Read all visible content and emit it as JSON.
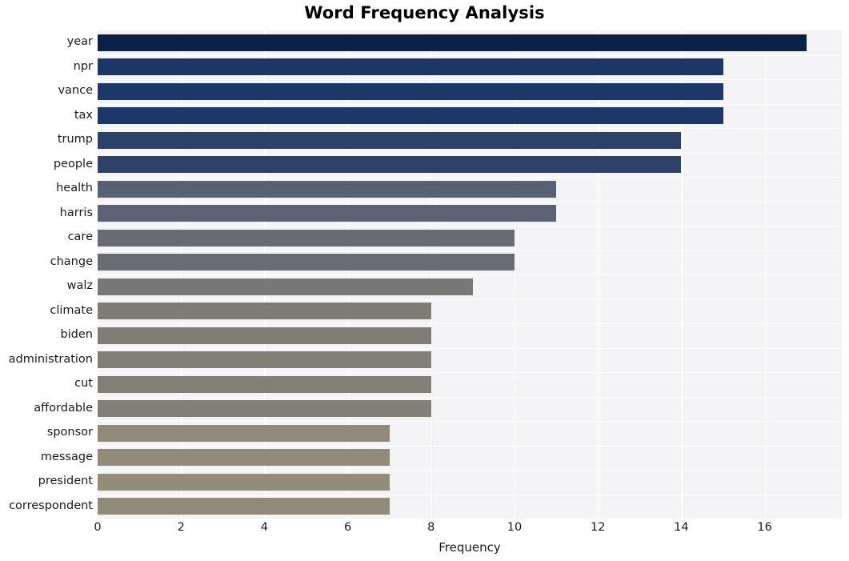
{
  "chart_data": {
    "type": "bar",
    "orientation": "horizontal",
    "title": "Word Frequency Analysis",
    "xlabel": "Frequency",
    "ylabel": "",
    "categories": [
      "year",
      "npr",
      "vance",
      "tax",
      "trump",
      "people",
      "health",
      "harris",
      "care",
      "change",
      "walz",
      "climate",
      "biden",
      "administration",
      "cut",
      "affordable",
      "sponsor",
      "message",
      "president",
      "correspondent"
    ],
    "values": [
      17,
      15,
      15,
      15,
      14,
      14,
      11,
      11,
      10,
      10,
      9,
      8,
      8,
      8,
      8,
      8,
      7,
      7,
      7,
      7
    ],
    "bar_colors": [
      "#0a2248",
      "#1c3668",
      "#1d3769",
      "#1d3769",
      "#2c4169",
      "#2d4269",
      "#586073",
      "#5a6274",
      "#696b74",
      "#6a6c75",
      "#777775",
      "#7e7c73",
      "#7f7d74",
      "#807e75",
      "#817f76",
      "#828076",
      "#928a78",
      "#938b79",
      "#938c79",
      "#918a78"
    ],
    "xticks": [
      0,
      2,
      4,
      6,
      8,
      10,
      12,
      14,
      16
    ],
    "xtick_labels": [
      "0",
      "2",
      "4",
      "6",
      "8",
      "10",
      "12",
      "14",
      "16"
    ],
    "xlim": [
      0,
      17.85
    ],
    "grid": true,
    "grid_color": "#ffffff",
    "plot_background": "#f4f4f6",
    "figure_background": "#ffffff",
    "legend": null
  }
}
